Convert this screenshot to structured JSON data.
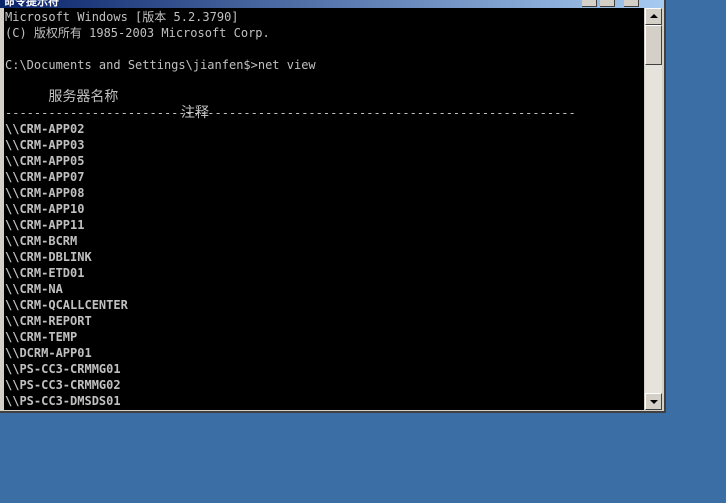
{
  "window": {
    "title": "命令提示符"
  },
  "console": {
    "version_line": "Microsoft Windows [版本 5.2.3790]",
    "copyright_line": "(C) 版权所有 1985-2003 Microsoft Corp.",
    "prompt_line": "C:\\Documents and Settings\\jianfen$>net view",
    "header_server": "服务器名称",
    "header_comment": "注释",
    "separator": "-------------------------------------------------------------------------------",
    "servers": [
      "\\\\CRM-APP02",
      "\\\\CRM-APP03",
      "\\\\CRM-APP05",
      "\\\\CRM-APP07",
      "\\\\CRM-APP08",
      "\\\\CRM-APP10",
      "\\\\CRM-APP11",
      "\\\\CRM-BCRM",
      "\\\\CRM-DBLINK",
      "\\\\CRM-ETD01",
      "\\\\CRM-NA",
      "\\\\CRM-QCALLCENTER",
      "\\\\CRM-REPORT",
      "\\\\CRM-TEMP",
      "\\\\DCRM-APP01",
      "\\\\PS-CC3-CRMMG01",
      "\\\\PS-CC3-CRMMG02",
      "\\\\PS-CC3-DMSDS01"
    ]
  },
  "scrollbar": {
    "up_icon": "arrow-up-icon",
    "down_icon": "arrow-down-icon"
  }
}
